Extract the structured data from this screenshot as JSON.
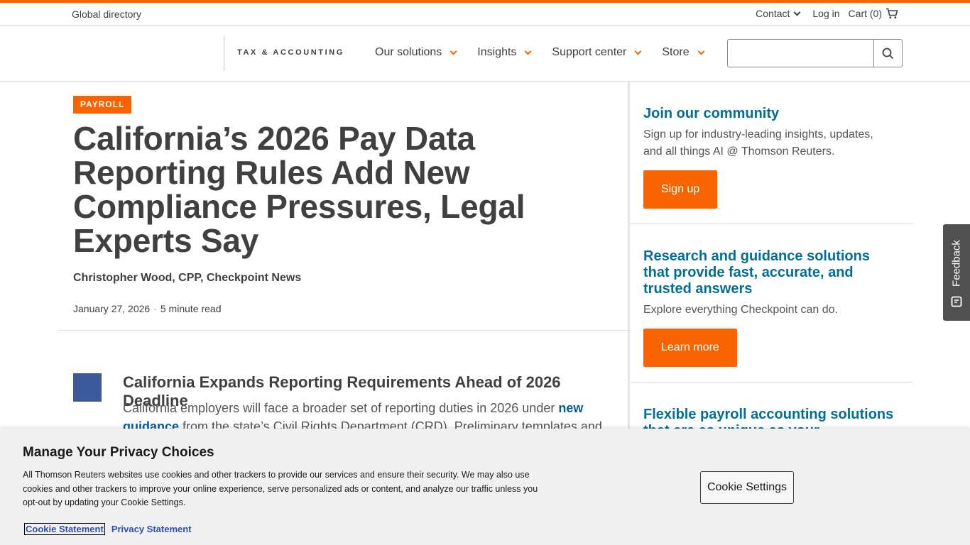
{
  "colors": {
    "accent": "#fa6400",
    "link": "#006e96",
    "thumb": "#3c5a9a"
  },
  "utility": {
    "global_directory": "Global directory",
    "contact": "Contact",
    "login": "Log in",
    "cart": "Cart (0)"
  },
  "header": {
    "brand": "TAX & ACCOUNTING",
    "nav": [
      "Our solutions",
      "Insights",
      "Support center",
      "Store"
    ],
    "search_placeholder": ""
  },
  "article": {
    "tag": "PAYROLL",
    "headline": "California’s 2026 Pay Data Reporting Rules Add New Compliance Pressures, Legal Experts Say",
    "byline": "Christopher Wood, CPP, Checkpoint News",
    "date": "January 27, 2026",
    "separator": "·",
    "read_time": "5 minute read",
    "section_title": "California Expands Reporting Requirements Ahead of 2026 Deadline",
    "body_pre": "California employers will face a broader set of reporting duties in 2026 under ",
    "body_link": "new guidance",
    "body_post": " from the state’s Civil Rights Department (CRD). Preliminary templates and"
  },
  "sidebar": [
    {
      "heading": "Join our community",
      "text": "Sign up for industry-leading insights, updates, and all things AI @ Thomson Reuters.",
      "button": "Sign up"
    },
    {
      "heading": "Research and guidance solutions that provide fast, accurate, and trusted answers",
      "text": "Explore everything Checkpoint can do.",
      "button": "Learn more"
    },
    {
      "heading": "Flexible payroll accounting solutions that are as unique as your"
    }
  ],
  "feedback": {
    "label": "Feedback"
  },
  "cookie": {
    "title": "Manage Your Privacy Choices",
    "text": "All Thomson Reuters websites use cookies and other trackers to provide our services and ensure their security. We may also use cookies and other trackers to improve your online experience, serve personalized ads or content, and analyze our traffic unless you opt-out by updating your Cookie Settings.",
    "link_cookie_statement": "Cookie Statement",
    "link_privacy_statement": "Privacy Statement",
    "settings_button": "Cookie Settings"
  }
}
